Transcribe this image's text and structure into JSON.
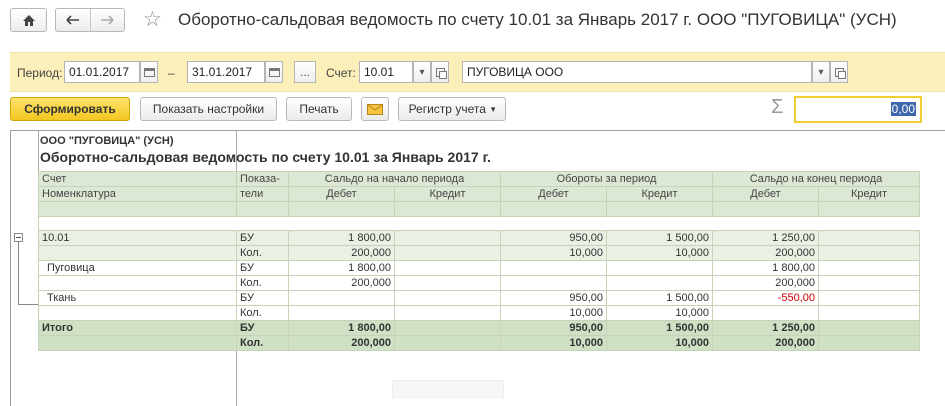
{
  "window": {
    "title": "Оборотно-сальдовая ведомость по счету 10.01 за Январь 2017 г. ООО \"ПУГОВИЦА\" (УСН)"
  },
  "filters": {
    "period_label": "Период:",
    "date_from": "01.01.2017",
    "dash": "–",
    "date_to": "31.01.2017",
    "ellipsis": "...",
    "account_label": "Счет:",
    "account_value": "10.01",
    "organization_value": "ПУГОВИЦА ООО"
  },
  "toolbar": {
    "generate": "Сформировать",
    "show_settings": "Показать настройки",
    "print": "Печать",
    "register": "Регистр учета",
    "sum_symbol": "Σ",
    "sum_value": "0,00"
  },
  "report": {
    "company": "ООО \"ПУГОВИЦА\" (УСН)",
    "title": "Оборотно-сальдовая ведомость по счету 10.01 за Январь 2017 г.",
    "headers": {
      "account": "Счет",
      "nomenclature": "Номенклатура",
      "indicators_1": "Показа-",
      "indicators_2": "тели",
      "opening": "Сальдо на начало периода",
      "turnover": "Обороты за период",
      "closing": "Сальдо на конец периода",
      "debit": "Дебет",
      "credit": "Кредит"
    },
    "rows": [
      {
        "name": "10.01",
        "ind": "БУ",
        "od": "1 800,00",
        "oc": "",
        "td": "950,00",
        "tc": "1 500,00",
        "cd": "1 250,00",
        "cc": ""
      },
      {
        "name": "",
        "ind": "Кол.",
        "od": "200,000",
        "oc": "",
        "td": "10,000",
        "tc": "10,000",
        "cd": "200,000",
        "cc": ""
      },
      {
        "name": "Пуговица",
        "ind": "БУ",
        "od": "1 800,00",
        "oc": "",
        "td": "",
        "tc": "",
        "cd": "1 800,00",
        "cc": ""
      },
      {
        "name": "",
        "ind": "Кол.",
        "od": "200,000",
        "oc": "",
        "td": "",
        "tc": "",
        "cd": "200,000",
        "cc": ""
      },
      {
        "name": "Ткань",
        "ind": "БУ",
        "od": "",
        "oc": "",
        "td": "950,00",
        "tc": "1 500,00",
        "cd": "-550,00",
        "cc": ""
      },
      {
        "name": "",
        "ind": "Кол.",
        "od": "",
        "oc": "",
        "td": "10,000",
        "tc": "10,000",
        "cd": "",
        "cc": ""
      },
      {
        "name": "Итого",
        "ind": "БУ",
        "od": "1 800,00",
        "oc": "",
        "td": "950,00",
        "tc": "1 500,00",
        "cd": "1 250,00",
        "cc": ""
      },
      {
        "name": "",
        "ind": "Кол.",
        "od": "200,000",
        "oc": "",
        "td": "10,000",
        "tc": "10,000",
        "cd": "200,000",
        "cc": ""
      }
    ]
  },
  "colors": {
    "filter_bg": "#fbf0b9",
    "primary_button": "#f3c620",
    "header_bg": "#dde8d4",
    "total_bg": "#cfe0c4",
    "negative": "#d00000"
  },
  "icons": [
    "home-icon",
    "back-arrow-icon",
    "forward-arrow-icon",
    "star-icon",
    "calendar-icon",
    "dropdown-icon",
    "open-icon",
    "envelope-icon",
    "collapse-icon"
  ]
}
